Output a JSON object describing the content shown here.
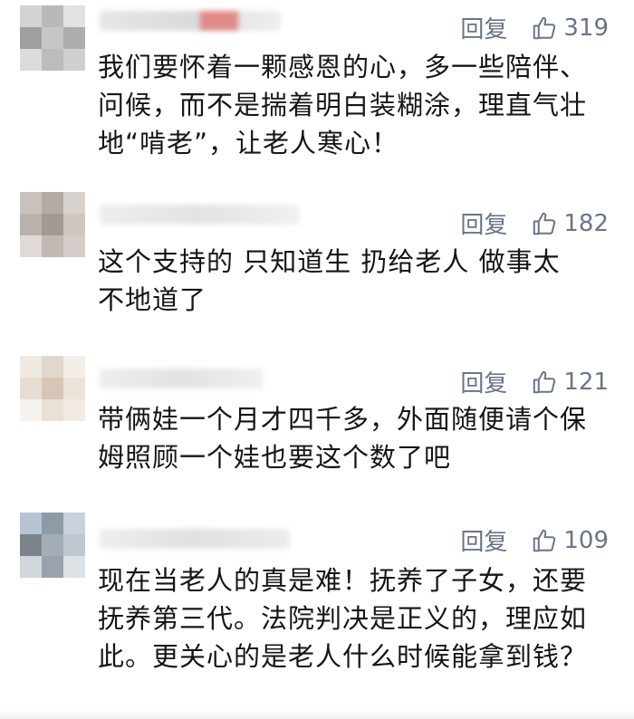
{
  "comments": [
    {
      "reply_label": "回复",
      "likes": "319",
      "text": "我们要怀着一颗感恩的心，多一些陪伴、问候，而不是揣着明白装糊涂，理直气壮地“啃老”，让老人寒心！",
      "avatar_colors": [
        "#d4d4d4",
        "#b9b9b9",
        "#e2e2e2",
        "#9f9f9f",
        "#c6c6c6",
        "#aeaeae",
        "#dcdcdc",
        "#bcbcbc",
        "#cfcfcf"
      ]
    },
    {
      "reply_label": "回复",
      "likes": "182",
      "text": "这个支持的 只知道生 扔给老人 做事太不地道了",
      "avatar_colors": [
        "#c9c1bd",
        "#b4aaa6",
        "#d8d2ce",
        "#bcb2ad",
        "#a59994",
        "#cfc6c2",
        "#e0dbd8",
        "#c2b9b5",
        "#d3ccc8"
      ]
    },
    {
      "reply_label": "回复",
      "likes": "121",
      "text": "带俩娃一个月才四千多，外面随便请个保姆照顾一个娃也要这个数了吧",
      "avatar_colors": [
        "#efe9e2",
        "#e2d7cc",
        "#f3eee8",
        "#e7ddd2",
        "#d6c6b6",
        "#ece4da",
        "#f6f2ed",
        "#e9e0d6",
        "#f1ebe4"
      ]
    },
    {
      "reply_label": "回复",
      "likes": "109",
      "text": "现在当老人的真是难！抚养了子女，还要抚养第三代。法院判决是正义的，理应如此。更关心的是老人什么时候能拿到钱？",
      "avatar_colors": [
        "#b8c4d3",
        "#8f9aa7",
        "#c9d2dc",
        "#7d848c",
        "#a3adb8",
        "#c0c7cf",
        "#d0d6dc",
        "#9aa3ad",
        "#dde2e7"
      ]
    }
  ],
  "colors": {
    "action_text": "#6a7587",
    "comment_text": "#151515",
    "name_highlight": "#e08a8a"
  },
  "icons": {
    "like": "thumbs-up-icon"
  }
}
